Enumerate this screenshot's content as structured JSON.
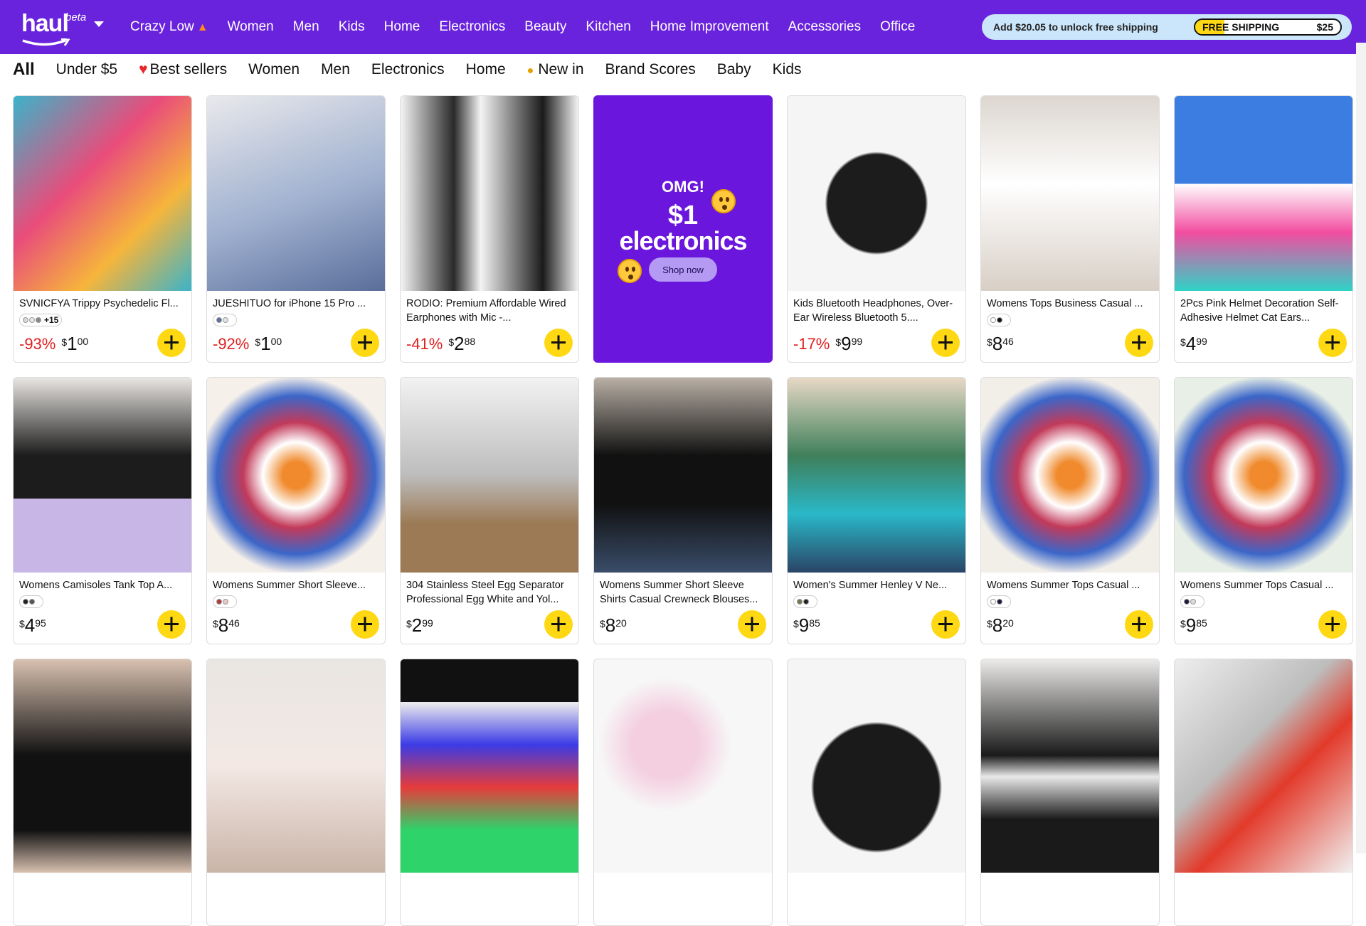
{
  "brand": {
    "name": "haul",
    "badge": "beta"
  },
  "top_nav": [
    "Crazy Low",
    "Women",
    "Men",
    "Kids",
    "Home",
    "Electronics",
    "Beauty",
    "Kitchen",
    "Home Improvement",
    "Accessories",
    "Office"
  ],
  "shipping": {
    "message": "Add $20.05 to unlock free shipping",
    "label": "FREE SHIPPING",
    "threshold": "$25",
    "progress_fraction": 0.2
  },
  "categories": [
    "All",
    "Under $5",
    "Best sellers",
    "Women",
    "Men",
    "Electronics",
    "Home",
    "New in",
    "Brand Scores",
    "Baby",
    "Kids"
  ],
  "promo": {
    "line1": "OMG!",
    "line2": "$1",
    "line3": "electronics",
    "button": "Shop now"
  },
  "products": [
    {
      "title": "SVNICFYA Trippy Psychedelic Fl...",
      "discount": "-93%",
      "currency": "$",
      "whole": "1",
      "cents": "00",
      "swatch_more": "+15",
      "swatch_colors": [
        "#d8d8d8",
        "#e8e8e8",
        "#888888"
      ]
    },
    {
      "title": "JUESHITUO for iPhone 15 Pro ...",
      "discount": "-92%",
      "currency": "$",
      "whole": "1",
      "cents": "00",
      "swatch_more": "",
      "swatch_colors": [
        "#5a6e9a",
        "#dfe4ee"
      ]
    },
    {
      "title": "RODIO: Premium Affordable Wired Earphones with Mic -...",
      "discount": "-41%",
      "currency": "$",
      "whole": "2",
      "cents": "88",
      "swatch_more": "",
      "swatch_colors": []
    },
    {
      "title": "Kids Bluetooth Headphones, Over-Ear Wireless Bluetooth 5....",
      "discount": "-17%",
      "currency": "$",
      "whole": "9",
      "cents": "99",
      "swatch_more": "",
      "swatch_colors": []
    },
    {
      "title": "Womens Tops Business Casual ...",
      "discount": "",
      "currency": "$",
      "whole": "8",
      "cents": "46",
      "swatch_more": "",
      "swatch_colors": [
        "#ffffff",
        "#111111"
      ]
    },
    {
      "title": "2Pcs Pink Helmet Decoration Self-Adhesive Helmet Cat Ears...",
      "discount": "",
      "currency": "$",
      "whole": "4",
      "cents": "99",
      "swatch_more": "",
      "swatch_colors": []
    },
    {
      "title": "Womens Camisoles Tank Top A...",
      "discount": "",
      "currency": "$",
      "whole": "4",
      "cents": "95",
      "swatch_more": "",
      "swatch_colors": [
        "#222222",
        "#555555"
      ]
    },
    {
      "title": "Womens Summer Short Sleeve...",
      "discount": "",
      "currency": "$",
      "whole": "8",
      "cents": "46",
      "swatch_more": "",
      "swatch_colors": [
        "#b33a3a",
        "#e8c8c8"
      ]
    },
    {
      "title": "304 Stainless Steel Egg Separator Professional Egg White and Yol...",
      "discount": "",
      "currency": "$",
      "whole": "2",
      "cents": "99",
      "swatch_more": "",
      "swatch_colors": []
    },
    {
      "title": "Womens Summer Short Sleeve Shirts Casual Crewneck Blouses...",
      "discount": "",
      "currency": "$",
      "whole": "8",
      "cents": "20",
      "swatch_more": "",
      "swatch_colors": []
    },
    {
      "title": "Women's Summer Henley V Ne...",
      "discount": "",
      "currency": "$",
      "whole": "9",
      "cents": "85",
      "swatch_more": "",
      "swatch_colors": [
        "#6d7a4e",
        "#222222"
      ]
    },
    {
      "title": "Womens Summer Tops Casual ...",
      "discount": "",
      "currency": "$",
      "whole": "8",
      "cents": "20",
      "swatch_more": "",
      "swatch_colors": [
        "#ffffff",
        "#1a1a3a"
      ]
    },
    {
      "title": "Womens Summer Tops Casual ...",
      "discount": "",
      "currency": "$",
      "whole": "9",
      "cents": "85",
      "swatch_more": "",
      "swatch_colors": [
        "#1a1a3a",
        "#dddddd"
      ]
    }
  ],
  "icons": {
    "logo_smile": "smile-arrow-icon",
    "dropdown": "chevron-down-icon",
    "add": "plus-icon",
    "heart": "heart-icon",
    "new": "chick-icon",
    "flame": "flame-icon"
  }
}
